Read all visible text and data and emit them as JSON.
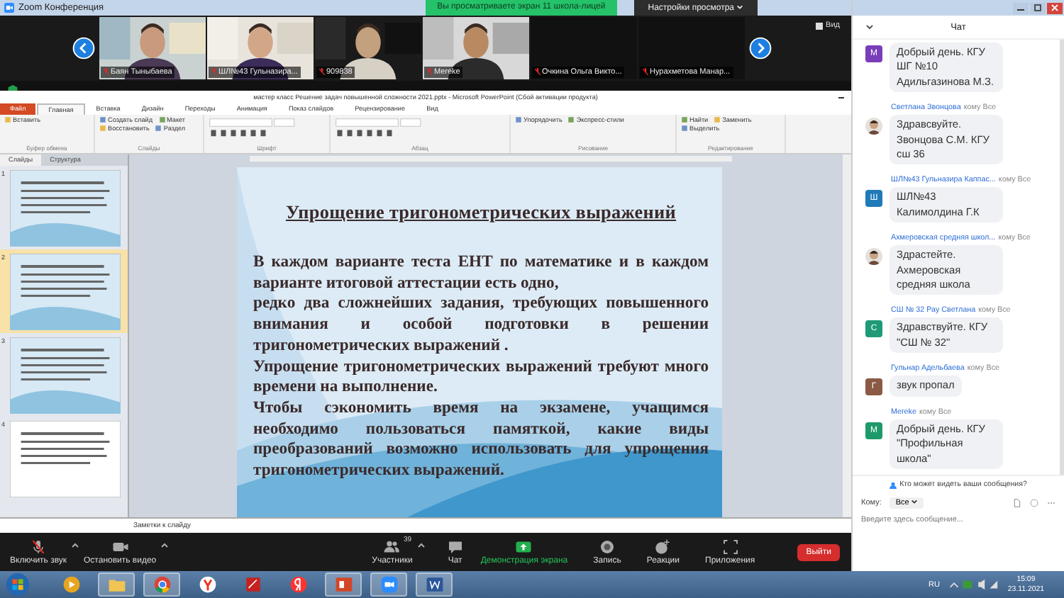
{
  "zoom_window": {
    "title": "Zoom Конференция",
    "share_banner": "Вы просматриваете экран 11 школа-лицей",
    "view_options": "Настройки просмотра",
    "view_button": "Вид"
  },
  "video_strip": [
    {
      "name": "Баян Тыныбаева",
      "video": true
    },
    {
      "name": "ШЛ№43 Гульназира...",
      "video": true
    },
    {
      "name": "909838",
      "video": true
    },
    {
      "name": "Mereke",
      "video": true
    },
    {
      "name": "Очкина Ольга Викто...",
      "video": false
    },
    {
      "name": "Нурахметова Манар...",
      "video": false
    }
  ],
  "powerpoint": {
    "title": "мастер класс Решение задач повышенной сложности 2021.pptx - Microsoft PowerPoint (Сбой активации продукта)",
    "ribbon_tabs": [
      {
        "label": "Файл",
        "kind": "file",
        "selected": false
      },
      {
        "label": "Главная",
        "kind": "tab",
        "selected": true
      },
      {
        "label": "Вставка",
        "kind": "tab",
        "selected": false
      },
      {
        "label": "Дизайн",
        "kind": "tab",
        "selected": false
      },
      {
        "label": "Переходы",
        "kind": "tab",
        "selected": false
      },
      {
        "label": "Анимация",
        "kind": "tab",
        "selected": false
      },
      {
        "label": "Показ слайдов",
        "kind": "tab",
        "selected": false
      },
      {
        "label": "Рецензирование",
        "kind": "tab",
        "selected": false
      },
      {
        "label": "Вид",
        "kind": "tab",
        "selected": false
      }
    ],
    "ribbon_groups": [
      {
        "name": "Буфер обмена",
        "commands": [
          "Вставить"
        ]
      },
      {
        "name": "Слайды",
        "commands": [
          "Создать слайд",
          "Макет",
          "Восстановить",
          "Раздел"
        ]
      },
      {
        "name": "Шрифт"
      },
      {
        "name": "Абзац"
      },
      {
        "name": "Рисование",
        "commands": [
          "Упорядочить",
          "Экспресс-стили"
        ]
      },
      {
        "name": "Редактирование",
        "commands": [
          "Найти",
          "Заменить",
          "Выделить"
        ]
      }
    ],
    "pane_tabs": [
      {
        "label": "Слайды",
        "selected": true
      },
      {
        "label": "Структура",
        "selected": false
      }
    ],
    "slides": [
      {
        "number": "1",
        "selected": false
      },
      {
        "number": "2",
        "selected": true
      },
      {
        "number": "3",
        "selected": false
      },
      {
        "number": "4",
        "selected": false
      }
    ],
    "slide": {
      "title": "Упрощение тригонометрических выражений",
      "paragraphs": [
        "В каждом варианте теста ЕНТ по математике и в каждом варианте итоговой аттестации есть одно,",
        "редко два сложнейших задания, требующих повышенного внимания и особой подготовки в решении тригонометрических выражений .",
        "Упрощение тригонометрических выражений требуют много времени на выполнение.",
        "Чтобы сэкономить время на экзамене, учащимся необходимо пользоваться памяткой, какие виды преобразований возможно использовать для упрощения тригонометрических выражений."
      ]
    },
    "notes_placeholder": "Заметки к слайду"
  },
  "toolbar": {
    "items": [
      {
        "label": "Включить звук",
        "kind": "mic",
        "muted": true
      },
      {
        "label": "Остановить видео",
        "kind": "video"
      },
      {
        "label": "Участники",
        "kind": "participants",
        "count": "39"
      },
      {
        "label": "Чат",
        "kind": "chat"
      },
      {
        "label": "Демонстрация экрана",
        "kind": "share"
      },
      {
        "label": "Запись",
        "kind": "record"
      },
      {
        "label": "Реакции",
        "kind": "reactions"
      },
      {
        "label": "Приложения",
        "kind": "apps"
      }
    ],
    "leave": "Выйти"
  },
  "chat": {
    "title": "Чат",
    "messages": [
      {
        "avatar": {
          "kind": "letter",
          "letter": "М",
          "color": "#7a3db8"
        },
        "text": "Добрый день. КГУ ШГ №10 Адильгазинова М.З."
      },
      {
        "sender": "Светлана Звонцова",
        "recipient": "кому Все",
        "text": "Здравсвуйте. Звонцова С.М.  КГУ сш 36"
      },
      {
        "sender": "ШЛ№43 Гульназира Каппас...",
        "recipient": "кому Все",
        "avatar": {
          "kind": "letter",
          "letter": "Ш",
          "color": "#1f7ab8"
        },
        "text": "ШЛ№43 Калимолдина Г.К"
      },
      {
        "sender": "Ахмеровская средняя школ...",
        "recipient": "кому Все",
        "text": "Здрастейте. Ахмеровская средняя школа"
      },
      {
        "sender": "СШ № 32 Рау Светлана",
        "recipient": "кому Все",
        "avatar": {
          "kind": "letter",
          "letter": "С",
          "color": "#1e9a78"
        },
        "text": "Здравствуйте. КГУ \"СШ № 32\""
      },
      {
        "sender": "Гульнар Адельбаева",
        "recipient": "кому Все",
        "avatar": {
          "kind": "letter",
          "letter": "Г",
          "color": "#8a5a44"
        },
        "text": "звук пропал"
      },
      {
        "sender": "Mereke",
        "recipient": "кому Все",
        "avatar": {
          "kind": "letter",
          "letter": "М",
          "color": "#1e9a6a"
        },
        "text": "Добрый день. КГУ \"Профильная школа\""
      }
    ],
    "who_can_see": "Кто может видеть ваши сообщения?",
    "to_label": "Кому:",
    "to_value": "Все",
    "placeholder": "Введите здесь сообщение..."
  },
  "taskbar": {
    "apps": [
      {
        "kind": "media",
        "running": false
      },
      {
        "kind": "folder",
        "running": true
      },
      {
        "kind": "chrome",
        "running": true
      },
      {
        "kind": "yabrowser",
        "running": false
      },
      {
        "kind": "pdf",
        "running": false
      },
      {
        "kind": "yandex",
        "running": false
      },
      {
        "kind": "powerpoint",
        "running": true
      },
      {
        "kind": "zoom",
        "running": true
      },
      {
        "kind": "word",
        "running": true
      }
    ],
    "language": "RU",
    "time": "15:09",
    "date": "23.11.2021"
  }
}
